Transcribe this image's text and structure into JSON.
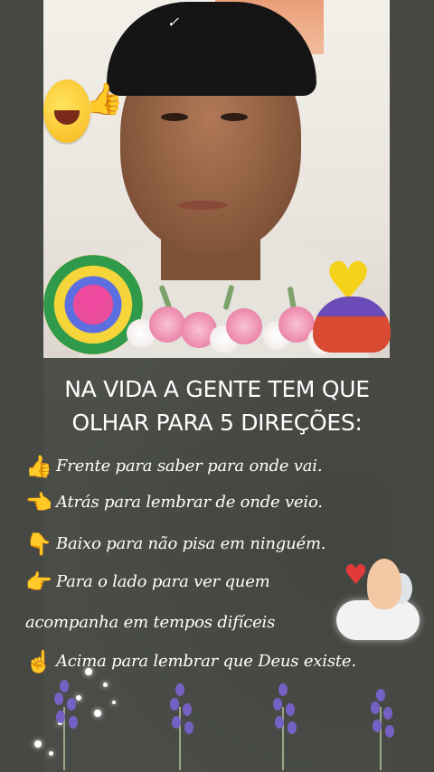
{
  "post": {
    "heading_line1": "NA VIDA A GENTE TEM QUE",
    "heading_line2": "OLHAR PARA 5 DIREÇÕES:",
    "items": [
      {
        "icon": "thumbs-up-icon",
        "glyph": "👍",
        "text": "Frente para saber para onde vai."
      },
      {
        "icon": "pointing-left-icon",
        "glyph": "👈",
        "text": "Atrás para lembrar de onde veio."
      },
      {
        "icon": "pointing-down-icon",
        "glyph": "👇",
        "text": "Baixo para não pisa em ninguém."
      },
      {
        "icon": "pointing-right-icon",
        "glyph": "👉",
        "text": "Para o lado para ver quem"
      },
      {
        "icon": "pointing-up-icon",
        "glyph": "☝",
        "text": "Acima para lembrar que Deus existe."
      }
    ],
    "item4_continuation": "acompanha em tempos difíceis"
  },
  "colors": {
    "background": "#4a4d47",
    "text": "#ffffff",
    "icon": "#f6c441",
    "lavender": "#7560c4"
  }
}
